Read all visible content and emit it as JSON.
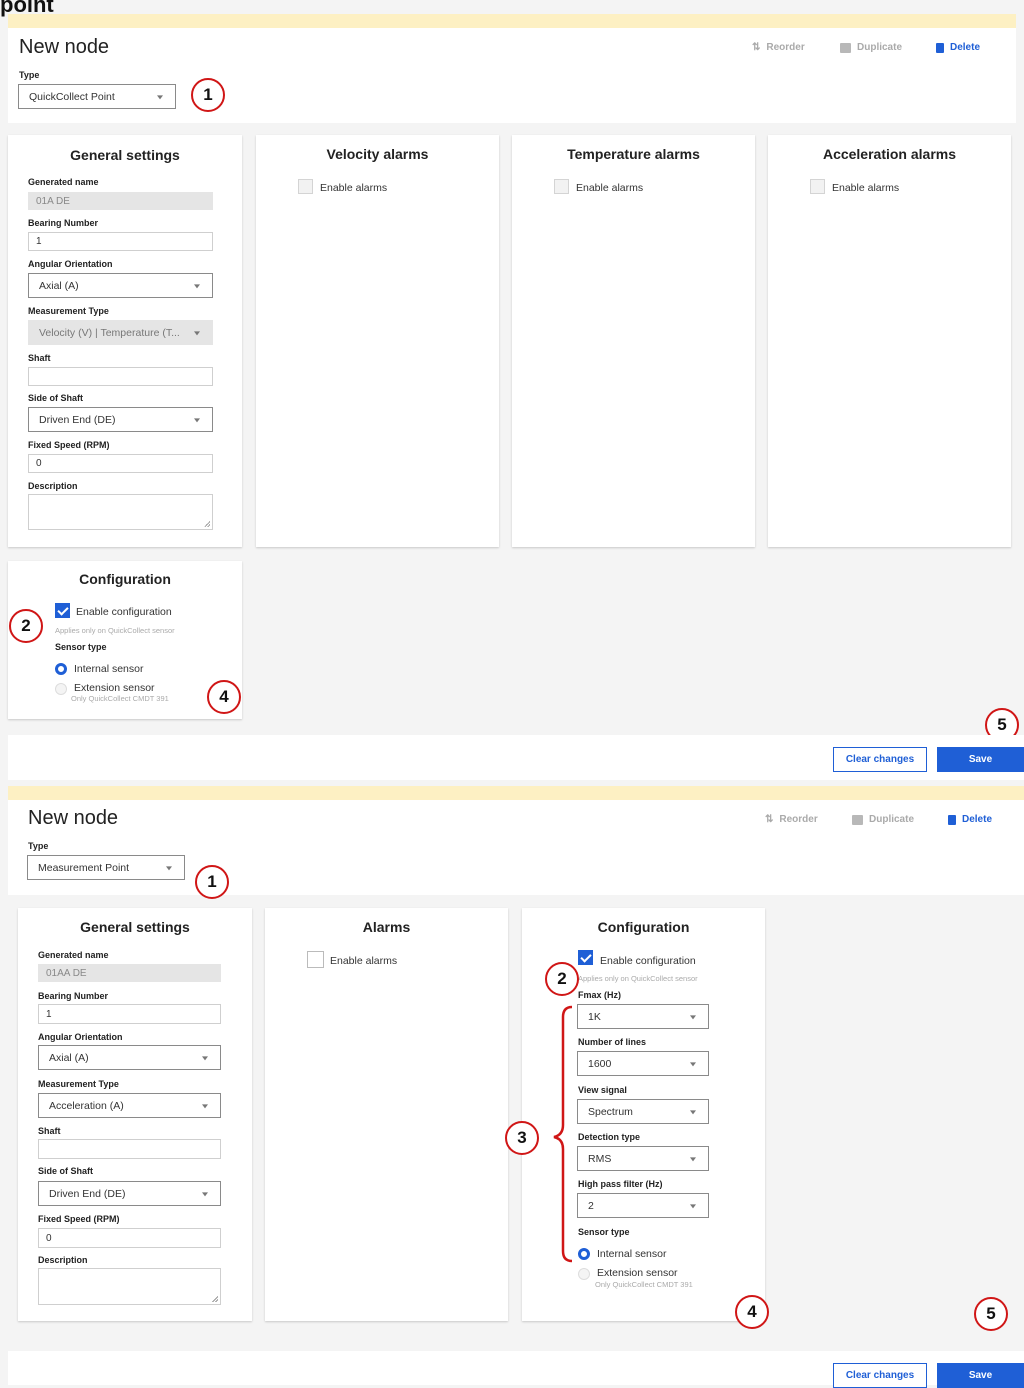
{
  "page": {
    "truncated_title": "point"
  },
  "screen1": {
    "header": {
      "title": "New node",
      "type_label": "Type",
      "type_value": "QuickCollect Point",
      "reorder_label": "Reorder",
      "duplicate_label": "Duplicate",
      "delete_label": "Delete"
    },
    "general": {
      "title": "General settings",
      "generated_name_label": "Generated name",
      "generated_name_value": "01A DE",
      "bearing_label": "Bearing Number",
      "bearing_value": "1",
      "angular_label": "Angular Orientation",
      "angular_value": "Axial (A)",
      "measurement_label": "Measurement Type",
      "measurement_value": "Velocity (V) | Temperature (T...",
      "shaft_label": "Shaft",
      "shaft_value": "",
      "side_label": "Side of Shaft",
      "side_value": "Driven End (DE)",
      "speed_label": "Fixed Speed (RPM)",
      "speed_value": "0",
      "description_label": "Description",
      "description_value": ""
    },
    "alarm_cards": [
      {
        "title": "Velocity alarms",
        "enable_label": "Enable alarms"
      },
      {
        "title": "Temperature alarms",
        "enable_label": "Enable alarms"
      },
      {
        "title": "Acceleration alarms",
        "enable_label": "Enable alarms"
      }
    ],
    "configuration": {
      "title": "Configuration",
      "enable_label": "Enable configuration",
      "hint": "Applies only on QuickCollect sensor",
      "sensor_type_label": "Sensor type",
      "internal_label": "Internal sensor",
      "extension_label": "Extension sensor",
      "extension_hint": "Only QuickCollect CMDT 391"
    },
    "footer": {
      "clear_label": "Clear changes",
      "save_label": "Save"
    },
    "callouts": {
      "c1": "1",
      "c2": "2",
      "c4": "4",
      "c5": "5"
    }
  },
  "screen2": {
    "header": {
      "title": "New node",
      "type_label": "Type",
      "type_value": "Measurement Point",
      "reorder_label": "Reorder",
      "duplicate_label": "Duplicate",
      "delete_label": "Delete"
    },
    "general": {
      "title": "General settings",
      "generated_name_label": "Generated name",
      "generated_name_value": "01AA DE",
      "bearing_label": "Bearing Number",
      "bearing_value": "1",
      "angular_label": "Angular Orientation",
      "angular_value": "Axial (A)",
      "measurement_label": "Measurement Type",
      "measurement_value": "Acceleration (A)",
      "shaft_label": "Shaft",
      "shaft_value": "",
      "side_label": "Side of Shaft",
      "side_value": "Driven End (DE)",
      "speed_label": "Fixed Speed (RPM)",
      "speed_value": "0",
      "description_label": "Description",
      "description_value": ""
    },
    "alarms": {
      "title": "Alarms",
      "enable_label": "Enable alarms"
    },
    "configuration": {
      "title": "Configuration",
      "enable_label": "Enable configuration",
      "hint": "Applies only on QuickCollect sensor",
      "fmax_label": "Fmax (Hz)",
      "fmax_value": "1K",
      "lines_label": "Number of lines",
      "lines_value": "1600",
      "view_label": "View signal",
      "view_value": "Spectrum",
      "detection_label": "Detection type",
      "detection_value": "RMS",
      "hpf_label": "High pass filter (Hz)",
      "hpf_value": "2",
      "sensor_type_label": "Sensor type",
      "internal_label": "Internal sensor",
      "extension_label": "Extension sensor",
      "extension_hint": "Only QuickCollect CMDT 391"
    },
    "footer": {
      "clear_label": "Clear changes",
      "save_label": "Save"
    },
    "callouts": {
      "c1": "1",
      "c2": "2",
      "c3": "3",
      "c4": "4",
      "c5": "5"
    }
  },
  "colors": {
    "accent": "#1f5fd6",
    "callout": "#d01616",
    "banner": "#fdf0c3"
  },
  "icons": [
    "reorder-icon",
    "duplicate-icon",
    "delete-icon",
    "caret-down-icon",
    "checkmark-icon",
    "bracket-icon"
  ]
}
